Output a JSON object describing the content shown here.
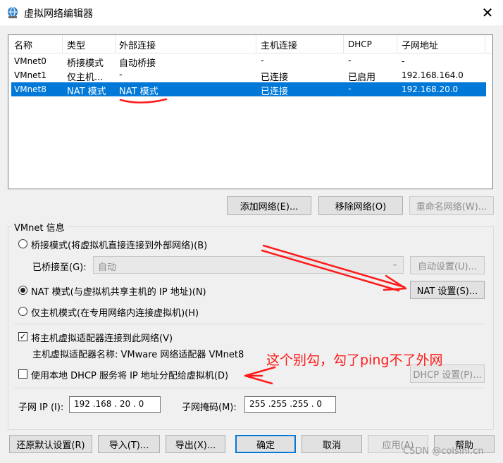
{
  "window": {
    "title": "虚拟网络编辑器",
    "close_symbol": "✕"
  },
  "table": {
    "headers": [
      "名称",
      "类型",
      "外部连接",
      "主机连接",
      "DHCP",
      "子网地址"
    ],
    "rows": [
      {
        "name": "VMnet0",
        "type": "桥接模式",
        "external": "自动桥接",
        "host": "-",
        "dhcp": "-",
        "subnet": "-",
        "selected": false
      },
      {
        "name": "VMnet1",
        "type": "仅主机...",
        "external": "-",
        "host": "已连接",
        "dhcp": "已启用",
        "subnet": "192.168.164.0",
        "selected": false
      },
      {
        "name": "VMnet8",
        "type": "NAT 模式",
        "external": "NAT 模式",
        "host": "已连接",
        "dhcp": "-",
        "subnet": "192.168.20.0",
        "selected": true
      }
    ]
  },
  "list_buttons": {
    "add": "添加网络(E)...",
    "remove": "移除网络(O)",
    "rename": "重命名网络(W)..."
  },
  "info": {
    "group_label": "VMnet 信息",
    "bridged_label": "桥接模式(将虚拟机直接连接到外部网络)(B)",
    "bridged_to_label": "已桥接至(G):",
    "bridged_to_value": "自动",
    "auto_settings": "自动设置(U)...",
    "nat_label": "NAT 模式(与虚拟机共享主机的 IP 地址)(N)",
    "nat_settings": "NAT 设置(S)...",
    "hostonly_label": "仅主机模式(在专用网络内连接虚拟机)(H)",
    "connect_adapter_label": "将主机虚拟适配器连接到此网络(V)",
    "adapter_name_label": "主机虚拟适配器名称: VMware 网络适配器 VMnet8",
    "dhcp_label": "使用本地 DHCP 服务将 IP 地址分配给虚拟机(D)",
    "dhcp_settings": "DHCP 设置(P)...",
    "subnet_ip_label": "子网 IP (I):",
    "subnet_ip_value": "192 .168 . 20 .  0",
    "subnet_mask_label": "子网掩码(M):",
    "subnet_mask_value": "255 .255 .255 .  0"
  },
  "bottom_buttons": {
    "restore": "还原默认设置(R)",
    "import": "导入(T)...",
    "export": "导出(X)...",
    "ok": "确定",
    "cancel": "取消",
    "apply": "应用(A)",
    "help": "帮助"
  },
  "annotation": {
    "text": "这个别勾，勾了ping不了外网",
    "color": "#ff1a1a"
  },
  "watermark": "CSDN @colsini.cn",
  "colors": {
    "selection": "#0078d7",
    "annotation": "#ff1a1a"
  }
}
